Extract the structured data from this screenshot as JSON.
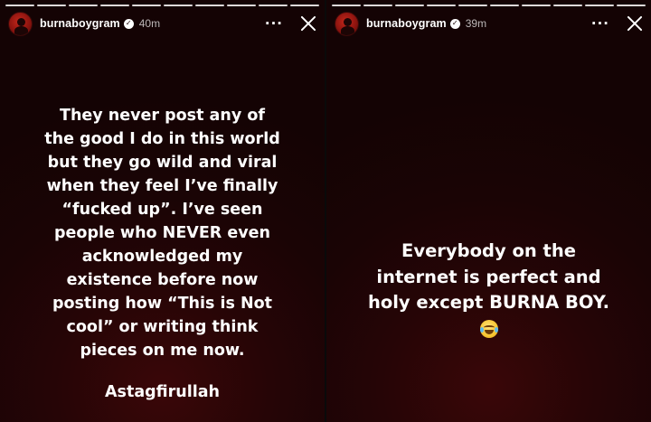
{
  "stories": [
    {
      "username": "burnaboygram",
      "time": "40m",
      "more_label": "···",
      "progress_segments": 10,
      "text_lines": [
        "They never post any of",
        "the good I do in this world",
        "but they go wild and viral",
        "when they feel I’ve finally",
        "“fucked up”.  I’ve seen",
        "people who NEVER even",
        "acknowledged my",
        "existence before now",
        "posting how “This is Not",
        "cool” or writing think",
        "pieces on me now."
      ],
      "signoff": "Astagfirullah"
    },
    {
      "username": "burnaboygram",
      "time": "39m",
      "more_label": "···",
      "progress_segments": 10,
      "text_lines": [
        "Everybody on the",
        "internet is perfect and",
        "holy except BURNA BOY."
      ],
      "emoji": "tears-of-joy-emoji"
    }
  ],
  "icons": {
    "verified": "verified-badge-icon",
    "more": "more-options-icon",
    "close": "close-icon"
  },
  "colors": {
    "background": "#1a0405",
    "text": "#ffffff"
  }
}
